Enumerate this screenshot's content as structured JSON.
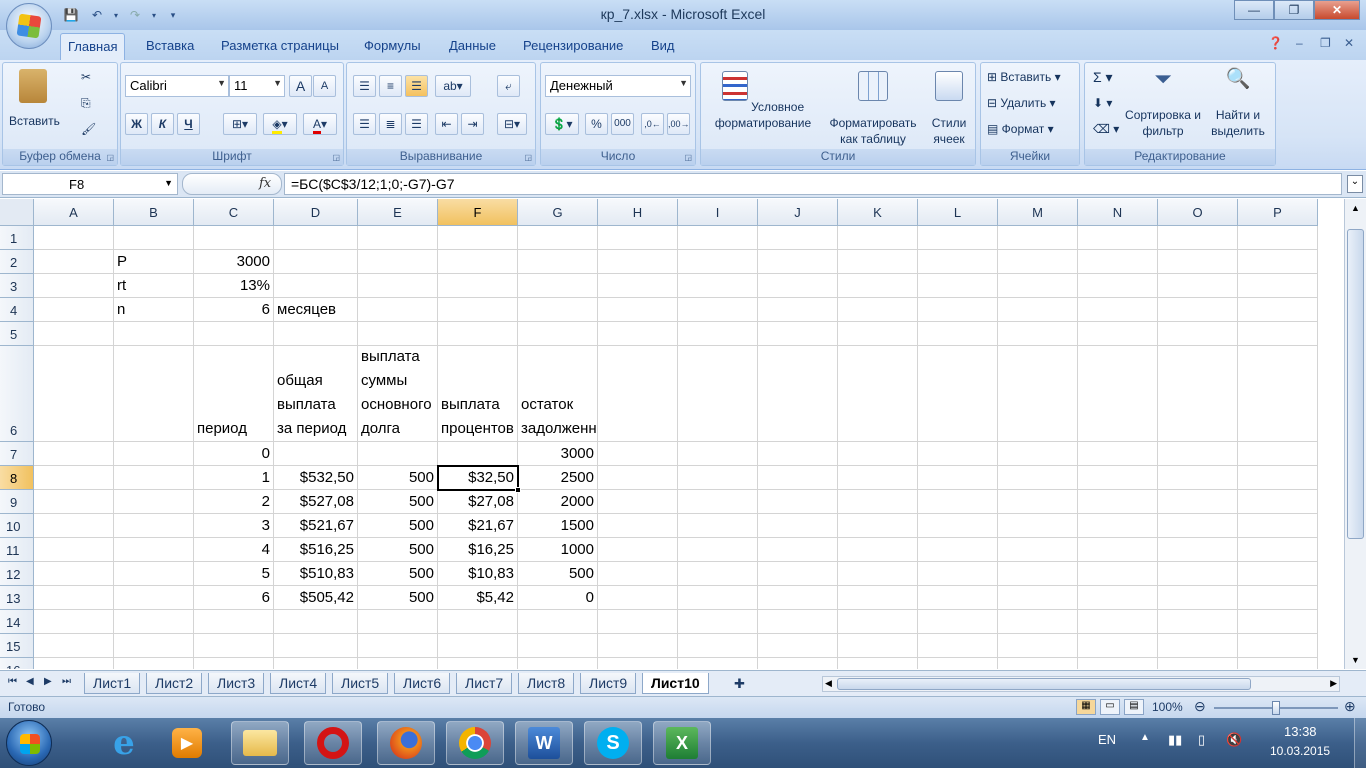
{
  "window": {
    "title": "кр_7.xlsx - Microsoft Excel",
    "buttons": [
      "minimize",
      "restore",
      "close"
    ]
  },
  "ribbon_tabs": [
    "Главная",
    "Вставка",
    "Разметка страницы",
    "Формулы",
    "Данные",
    "Рецензирование",
    "Вид"
  ],
  "active_tab": "Главная",
  "ribbon": {
    "clipboard": {
      "paste": "Вставить",
      "label": "Буфер обмена"
    },
    "font": {
      "name": "Calibri",
      "size": "11",
      "bold": "Ж",
      "italic": "К",
      "underline": "Ч",
      "label": "Шрифт",
      "grow": "A",
      "shrink": "A"
    },
    "alignment": {
      "label": "Выравнивание"
    },
    "number": {
      "format": "Денежный",
      "percent": "%",
      "thousands": "000",
      "label": "Число"
    },
    "styles": {
      "conditional": "Условное форматирование",
      "table": "Форматировать как таблицу",
      "cell_styles": "Стили ячеек",
      "label": "Стили"
    },
    "cells": {
      "insert": "Вставить",
      "delete": "Удалить",
      "format": "Формат",
      "label": "Ячейки"
    },
    "editing": {
      "sum": "Σ",
      "sort": "Сортировка и фильтр",
      "find": "Найти и выделить",
      "label": "Редактирование"
    }
  },
  "formula_bar": {
    "name_box": "F8",
    "fx": "fx",
    "formula": "=БС($C$3/12;1;0;-G7)-G7"
  },
  "columns": [
    "A",
    "B",
    "C",
    "D",
    "E",
    "F",
    "G",
    "H",
    "I",
    "J",
    "K",
    "L",
    "M",
    "N",
    "O",
    "P"
  ],
  "selected_column": "F",
  "rows": [
    "1",
    "2",
    "3",
    "4",
    "5",
    "6",
    "7",
    "8",
    "9",
    "10",
    "11",
    "12",
    "13",
    "14",
    "15",
    "16"
  ],
  "selected_row": "8",
  "cells": {
    "B2": "P",
    "C2": "3000",
    "B3": "rt",
    "C3": "13%",
    "B4": "n",
    "C4": "6",
    "D4": "месяцев",
    "C6": "период",
    "D6": "общая выплата за период",
    "E6": "выплата суммы основного долга",
    "F6": "выплата процентов",
    "G6": "остаток задолженности",
    "C7": "0",
    "G7": "3000",
    "C8": "1",
    "D8": "$532,50",
    "E8": "500",
    "F8": "$32,50",
    "G8": "2500",
    "C9": "2",
    "D9": "$527,08",
    "E9": "500",
    "F9": "$27,08",
    "G9": "2000",
    "C10": "3",
    "D10": "$521,67",
    "E10": "500",
    "F10": "$21,67",
    "G10": "1500",
    "C11": "4",
    "D11": "$516,25",
    "E11": "500",
    "F11": "$16,25",
    "G11": "1000",
    "C12": "5",
    "D12": "$510,83",
    "E12": "500",
    "F12": "$10,83",
    "G12": "500",
    "C13": "6",
    "D13": "$505,42",
    "E13": "500",
    "F13": "$5,42",
    "G13": "0"
  },
  "sheet_tabs": [
    "Лист1",
    "Лист2",
    "Лист3",
    "Лист4",
    "Лист5",
    "Лист6",
    "Лист7",
    "Лист8",
    "Лист9",
    "Лист10"
  ],
  "active_sheet": "Лист10",
  "status": {
    "ready": "Готово",
    "zoom": "100%"
  },
  "taskbar": {
    "apps": [
      "internet-explorer",
      "media-player",
      "file-explorer",
      "opera",
      "firefox",
      "chrome",
      "word",
      "skype",
      "excel"
    ],
    "lang": "EN",
    "time": "13:38",
    "date": "10.03.2015"
  },
  "colors": {
    "accent": "#15428b",
    "selection": "#f1c15f",
    "grid": "#d4d4d4"
  }
}
